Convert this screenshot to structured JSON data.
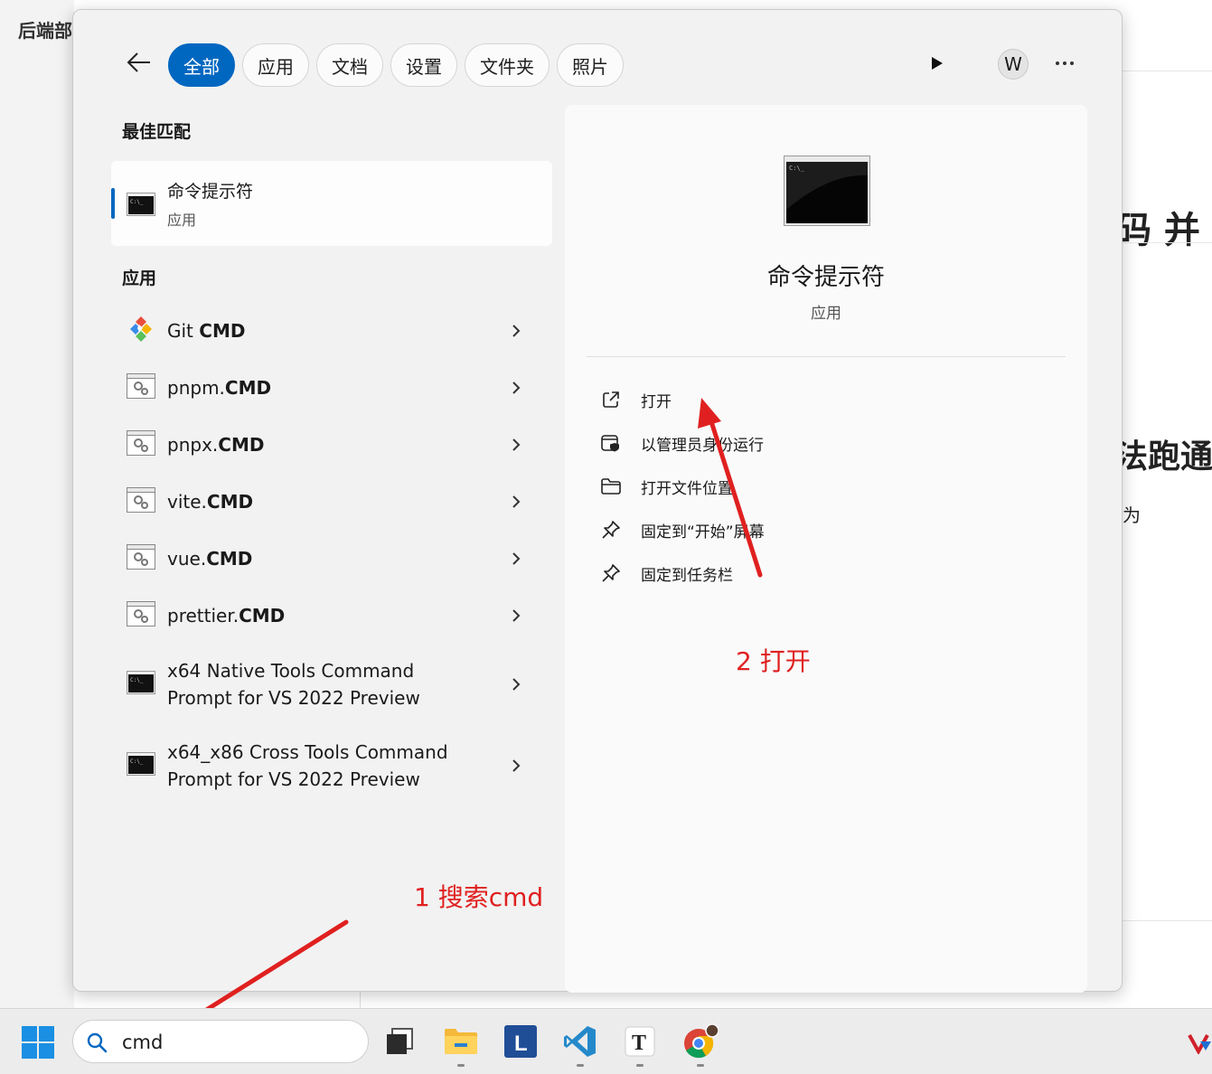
{
  "background": {
    "left_title": "后端部",
    "right_fragments": [
      "码 并",
      "法跑通",
      "为"
    ],
    "under_text": "( ... )"
  },
  "tabs": [
    "全部",
    "应用",
    "文档",
    "设置",
    "文件夹",
    "照片"
  ],
  "header": {
    "avatar_letter": "W",
    "more": "•••"
  },
  "best_match": {
    "section": "最佳匹配",
    "name": "命令提示符",
    "type": "应用"
  },
  "apps": {
    "section": "应用",
    "items": [
      {
        "plain": "Git ",
        "bold": "CMD",
        "icon": "git-icon"
      },
      {
        "plain": "pnpm.",
        "bold": "CMD",
        "icon": "batch-file-icon"
      },
      {
        "plain": "pnpx.",
        "bold": "CMD",
        "icon": "batch-file-icon"
      },
      {
        "plain": "vite.",
        "bold": "CMD",
        "icon": "batch-file-icon"
      },
      {
        "plain": "vue.",
        "bold": "CMD",
        "icon": "batch-file-icon"
      },
      {
        "plain": "prettier.",
        "bold": "CMD",
        "icon": "batch-file-icon"
      },
      {
        "line1": "x64 Native Tools Command",
        "line2": "Prompt for VS 2022 Preview",
        "icon": "terminal-icon"
      },
      {
        "line1": "x64_x86 Cross Tools Command",
        "line2": "Prompt for VS 2022 Preview",
        "icon": "terminal-icon"
      }
    ]
  },
  "detail": {
    "name": "命令提示符",
    "type": "应用",
    "actions": [
      {
        "label": "打开",
        "icon": "open-external-icon"
      },
      {
        "label": "以管理员身份运行",
        "icon": "run-as-admin-icon"
      },
      {
        "label": "打开文件位置",
        "icon": "folder-icon"
      },
      {
        "label": "固定到“开始”屏幕",
        "icon": "pin-icon"
      },
      {
        "label": "固定到任务栏",
        "icon": "pin-icon"
      }
    ]
  },
  "annotations": {
    "step1": "1 搜索cmd",
    "step2": "2 打开"
  },
  "taskbar": {
    "search_value": "cmd",
    "apps": [
      "task-view-icon",
      "file-explorer-icon",
      "l-app-icon",
      "vscode-icon",
      "typora-icon",
      "chrome-icon"
    ]
  },
  "colors": {
    "accent": "#0067c0",
    "annotation": "#e02020"
  }
}
